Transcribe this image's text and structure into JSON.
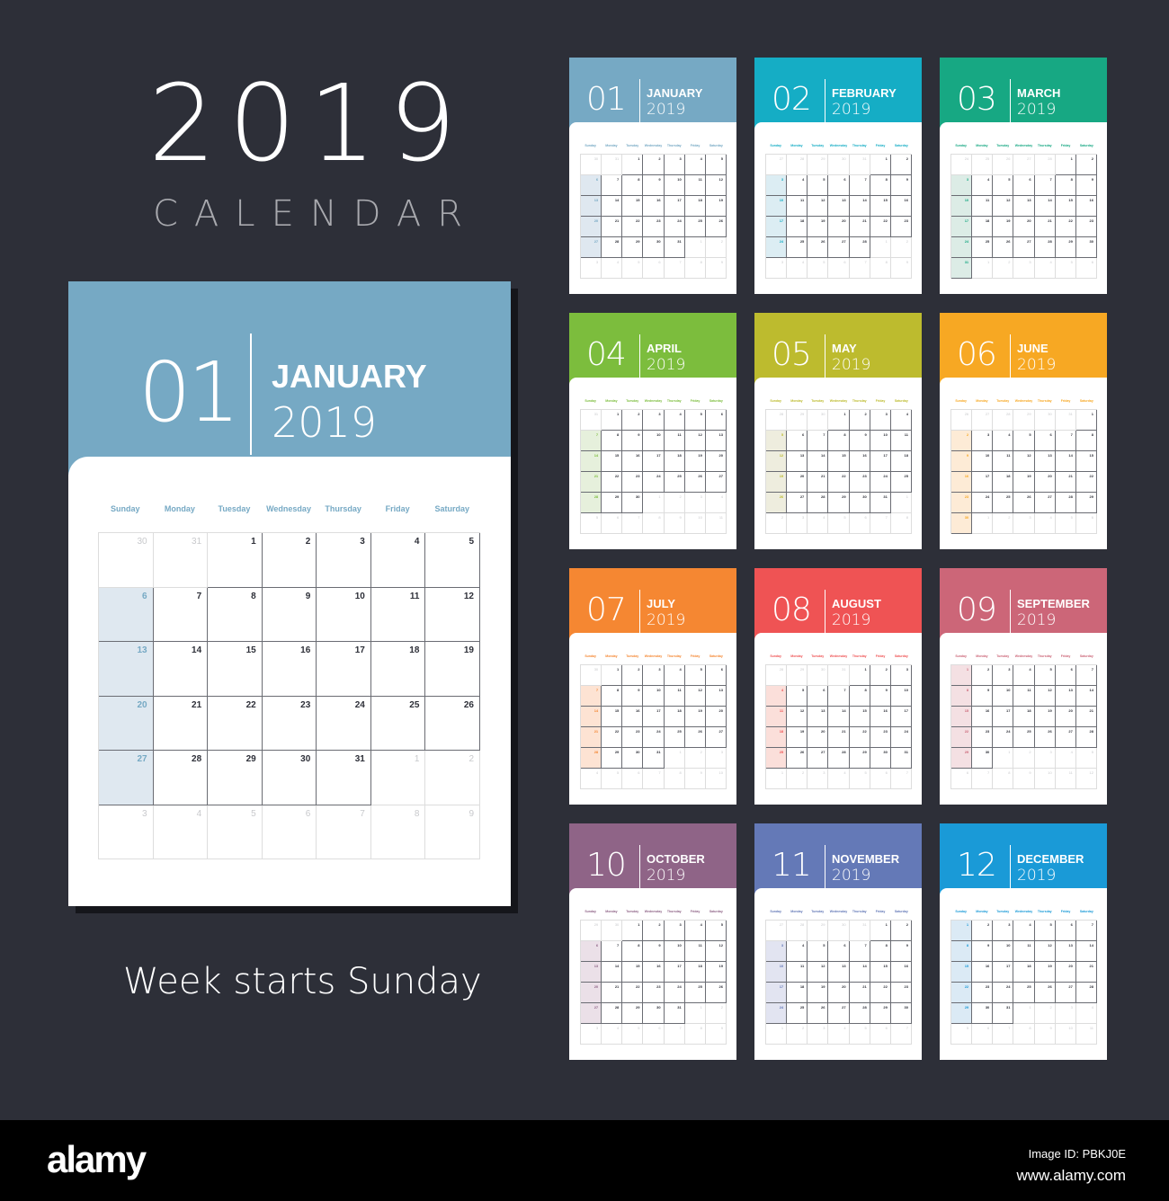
{
  "hero": {
    "year": "2019",
    "subtitle": "CALENDAR"
  },
  "tagline": "Week starts Sunday",
  "weekdays": [
    "Sunday",
    "Monday",
    "Tuesday",
    "Wednesday",
    "Thursday",
    "Friday",
    "Saturday"
  ],
  "featured_month_index": 0,
  "months": [
    {
      "num": "01",
      "name": "JANUARY",
      "year": "2019",
      "color": "#76a9c4",
      "tint": "#dfe8f0",
      "leading": [
        30,
        31
      ],
      "days": 31,
      "trailing": [
        1,
        2,
        3,
        4,
        5,
        6,
        7,
        8,
        9
      ]
    },
    {
      "num": "02",
      "name": "FEBRUARY",
      "year": "2019",
      "color": "#15adc5",
      "tint": "#dcedf3",
      "leading": [
        27,
        28,
        29,
        30,
        31
      ],
      "days": 28,
      "trailing": [
        1,
        2,
        3,
        4,
        5,
        6,
        7,
        8,
        9
      ]
    },
    {
      "num": "03",
      "name": "MARCH",
      "year": "2019",
      "color": "#17a883",
      "tint": "#dcece6",
      "leading": [
        24,
        25,
        26,
        27,
        28
      ],
      "days": 31,
      "trailing": [
        1,
        2,
        3,
        4,
        5,
        6
      ]
    },
    {
      "num": "04",
      "name": "APRIL",
      "year": "2019",
      "color": "#7cbd3d",
      "tint": "#e6f0dc",
      "leading": [
        31
      ],
      "days": 30,
      "trailing": [
        1,
        2,
        3,
        4,
        5,
        6,
        7,
        8,
        9,
        10,
        11
      ]
    },
    {
      "num": "05",
      "name": "MAY",
      "year": "2019",
      "color": "#bdbb2e",
      "tint": "#eeedde",
      "leading": [
        28,
        29,
        30
      ],
      "days": 31,
      "trailing": [
        1,
        2,
        3,
        4,
        5,
        6,
        7,
        8
      ]
    },
    {
      "num": "06",
      "name": "JUNE",
      "year": "2019",
      "color": "#f7a823",
      "tint": "#fdebd6",
      "leading": [
        26,
        27,
        28,
        29,
        30,
        31
      ],
      "days": 30,
      "trailing": [
        1,
        2,
        3,
        4,
        5,
        6
      ]
    },
    {
      "num": "07",
      "name": "JULY",
      "year": "2019",
      "color": "#f58732",
      "tint": "#fde3d3",
      "leading": [
        30
      ],
      "days": 31,
      "trailing": [
        1,
        2,
        3,
        4,
        5,
        6,
        7,
        8,
        9,
        10
      ]
    },
    {
      "num": "08",
      "name": "AUGUST",
      "year": "2019",
      "color": "#ef5354",
      "tint": "#fbdfda",
      "leading": [
        28,
        29,
        30,
        31
      ],
      "days": 31,
      "trailing": [
        1,
        2,
        3,
        4,
        5,
        6,
        7
      ]
    },
    {
      "num": "09",
      "name": "SEPTEMBER",
      "year": "2019",
      "color": "#cc6678",
      "tint": "#f4e0e3",
      "leading": [],
      "days": 30,
      "trailing": [
        1,
        2,
        3,
        4,
        5,
        6,
        7,
        8,
        9,
        10,
        11,
        12
      ]
    },
    {
      "num": "10",
      "name": "OCTOBER",
      "year": "2019",
      "color": "#8f6487",
      "tint": "#ebe0e8",
      "leading": [
        29,
        30
      ],
      "days": 31,
      "trailing": [
        1,
        2,
        3,
        4,
        5,
        6,
        7,
        8,
        9
      ]
    },
    {
      "num": "11",
      "name": "NOVEMBER",
      "year": "2019",
      "color": "#6479b7",
      "tint": "#e2e4f1",
      "leading": [
        27,
        28,
        29,
        30,
        31
      ],
      "days": 30,
      "trailing": [
        1,
        2,
        3,
        4,
        5,
        6,
        7
      ]
    },
    {
      "num": "12",
      "name": "DECEMBER",
      "year": "2019",
      "color": "#1a9ad7",
      "tint": "#dbeaf5",
      "leading": [],
      "days": 31,
      "trailing": [
        1,
        2,
        3,
        4,
        5,
        6,
        7,
        8,
        9,
        10,
        11
      ]
    }
  ],
  "footer": {
    "logo": "alamy",
    "image_id": "Image ID: PBKJ0E",
    "url": "www.alamy.com"
  }
}
